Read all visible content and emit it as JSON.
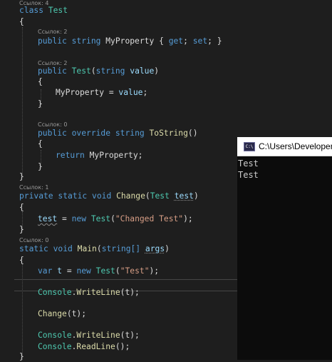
{
  "editor": {
    "lens": {
      "class_refs": "Ссылок: 4",
      "property_refs": "Ссылок: 2",
      "ctor_refs": "Ссылок: 2",
      "tostring_refs": "Ссылок: 0",
      "change_refs": "Ссылок: 1",
      "main_refs": "Ссылок: 0"
    },
    "code": {
      "l1_kw": "class",
      "l1_name": "Test",
      "open_brace": "{",
      "close_brace": "}",
      "prop_public": "public",
      "prop_type": "string",
      "prop_name": "MyProperty",
      "prop_ob": "{",
      "prop_get": "get",
      "prop_semi1": ";",
      "prop_set": "set",
      "prop_semi2": ";",
      "prop_cb": "}",
      "ctor_public": "public",
      "ctor_name": "Test",
      "ctor_open": "(",
      "ctor_ptype": "string",
      "ctor_pname": "value",
      "ctor_close": ")",
      "ctor_body_lhs": "MyProperty",
      "ctor_body_eq": " = ",
      "ctor_body_rhs": "value",
      "ctor_body_semi": ";",
      "ts_public": "public",
      "ts_override": "override",
      "ts_type": "string",
      "ts_name": "ToString",
      "ts_parens": "()",
      "ts_return": "return",
      "ts_value": "MyProperty",
      "ts_semi": ";",
      "ch_private": "private",
      "ch_static": "static",
      "ch_void": "void",
      "ch_name": "Change",
      "ch_open": "(",
      "ch_ptype": "Test",
      "ch_pname": "test",
      "ch_close": ")",
      "ch_body_lhs": "test",
      "ch_body_eq": " = ",
      "ch_body_new": "new",
      "ch_body_type": "Test",
      "ch_body_open": "(",
      "ch_body_str": "\"Changed Test\"",
      "ch_body_close": ");",
      "main_static": "static",
      "main_void": "void",
      "main_name": "Main",
      "main_open": "(",
      "main_ptype": "string[]",
      "main_pname": "args",
      "main_close": ")",
      "var_kw": "var",
      "var_name": "t",
      "var_eq": " = ",
      "var_new": "new",
      "var_type": "Test",
      "var_open": "(",
      "var_str": "\"Test\"",
      "var_close": ");",
      "wl1_cls": "Console",
      "wl1_dot": ".",
      "wl1_fn": "WriteLine",
      "wl1_args": "(t);",
      "chcall_fn": "Change",
      "chcall_args": "(t);",
      "wl2_cls": "Console",
      "wl2_dot": ".",
      "wl2_fn": "WriteLine",
      "wl2_args": "(t);",
      "rl_cls": "Console",
      "rl_dot": ".",
      "rl_fn": "ReadLine",
      "rl_args": "();"
    }
  },
  "console": {
    "title": "C:\\Users\\Developer\\",
    "icon_label": "C:\\",
    "output": [
      "Test",
      "Test"
    ]
  },
  "colors": {
    "background": "#1e1e1e",
    "keyword": "#569cd6",
    "type": "#4ec9b0",
    "method": "#dcdcaa",
    "string": "#d69d85",
    "parameter": "#9cdcfe",
    "console_bg": "#0c0c0c"
  }
}
